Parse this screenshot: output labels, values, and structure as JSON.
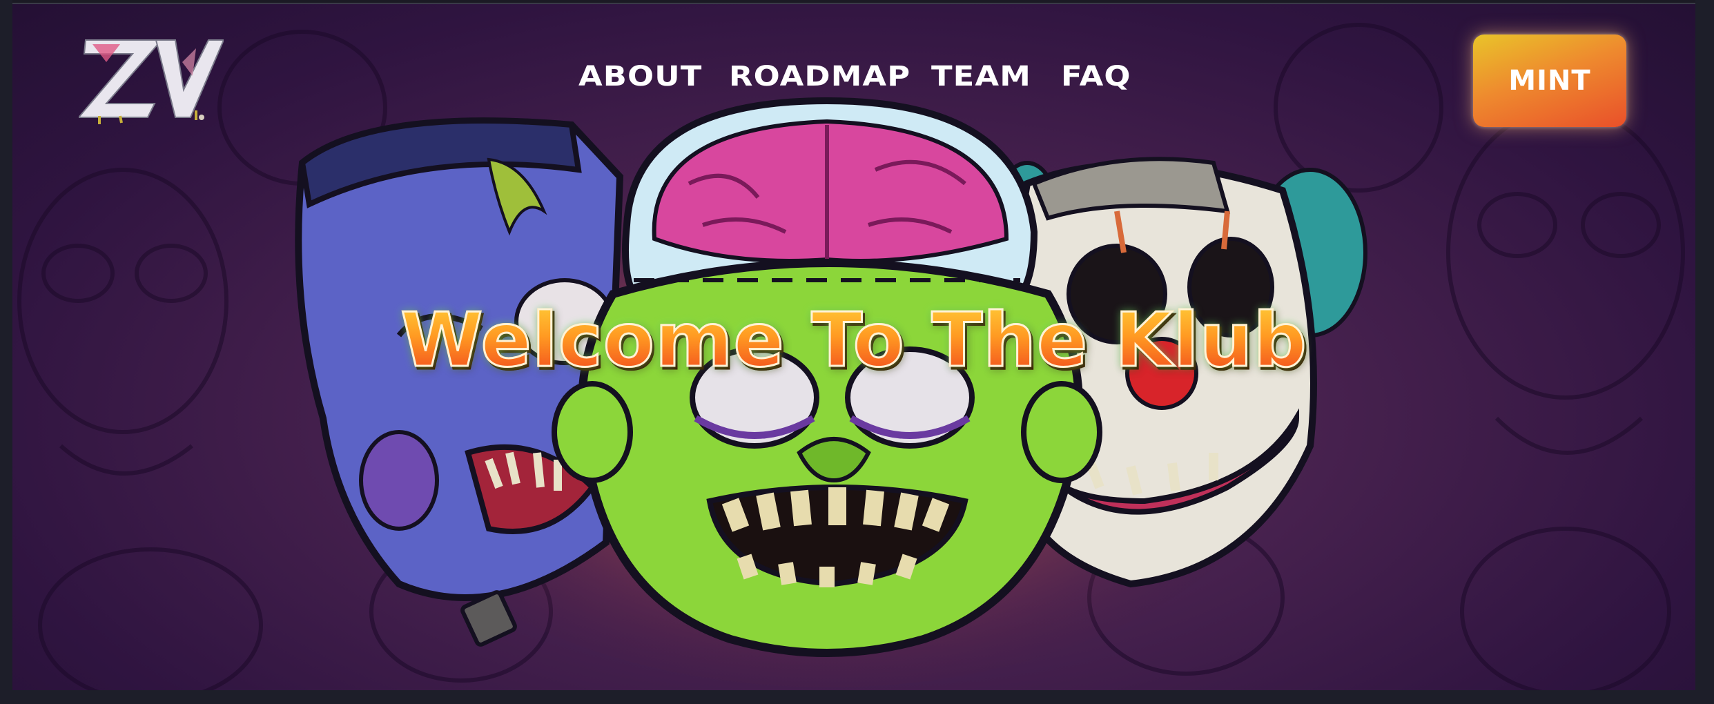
{
  "header": {
    "logo_text": "ZV",
    "nav": [
      {
        "label": "ABOUT"
      },
      {
        "label": "ROADMAP"
      },
      {
        "label": "TEAM"
      },
      {
        "label": "FAQ"
      }
    ],
    "mint_label": "MINT"
  },
  "hero": {
    "headline": "Welcome To The Klub",
    "characters": [
      "frankenstein-zombie",
      "brain-zombie",
      "clown-zombie"
    ]
  },
  "colors": {
    "background": "#2f1440",
    "accent_yellow": "#e9c42a",
    "accent_orange": "#ee8a2e",
    "accent_red": "#e9502a",
    "zombie_green": "#8cd63a",
    "brain_pink": "#d8479e"
  }
}
